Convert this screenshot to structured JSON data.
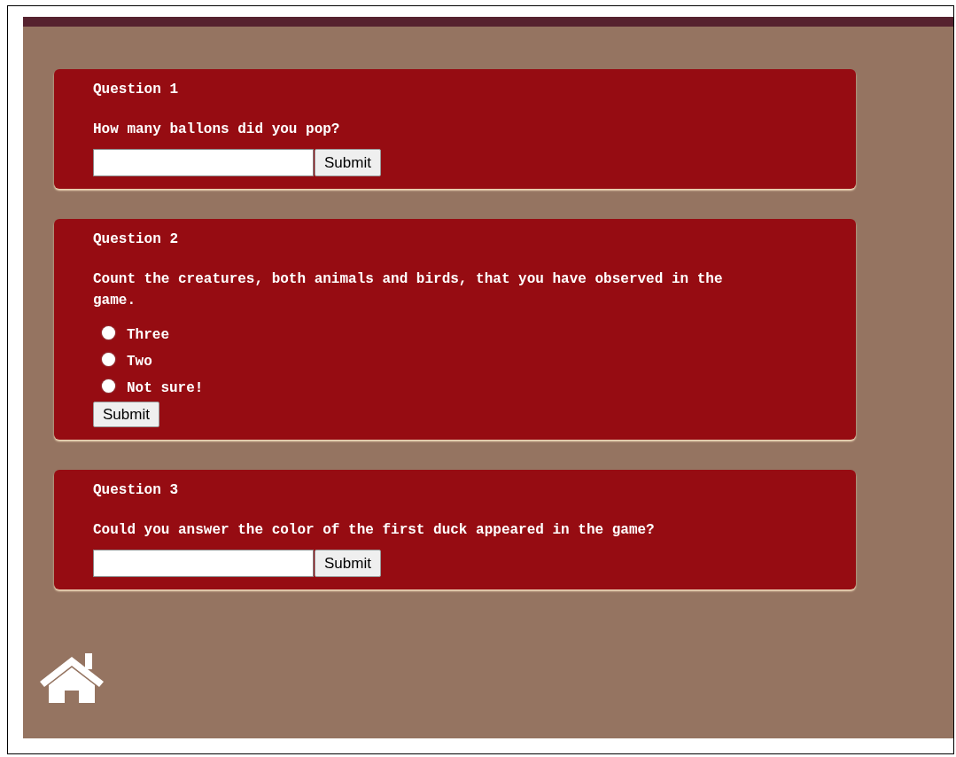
{
  "questions": [
    {
      "kind": "text",
      "title": "Question 1",
      "prompt": "How many ballons did you pop?",
      "submit": "Submit"
    },
    {
      "kind": "choice",
      "title": "Question 2",
      "prompt": "Count the creatures, both animals and birds, that you have observed in the game.",
      "options": [
        {
          "label": "Three",
          "selected": false
        },
        {
          "label": "Two",
          "selected": false
        },
        {
          "label": "Not sure!",
          "selected": false
        }
      ],
      "submit": "Submit"
    },
    {
      "kind": "text",
      "title": "Question 3",
      "prompt": "Could you answer the color of the first duck appeared in the game?",
      "submit": "Submit"
    }
  ]
}
